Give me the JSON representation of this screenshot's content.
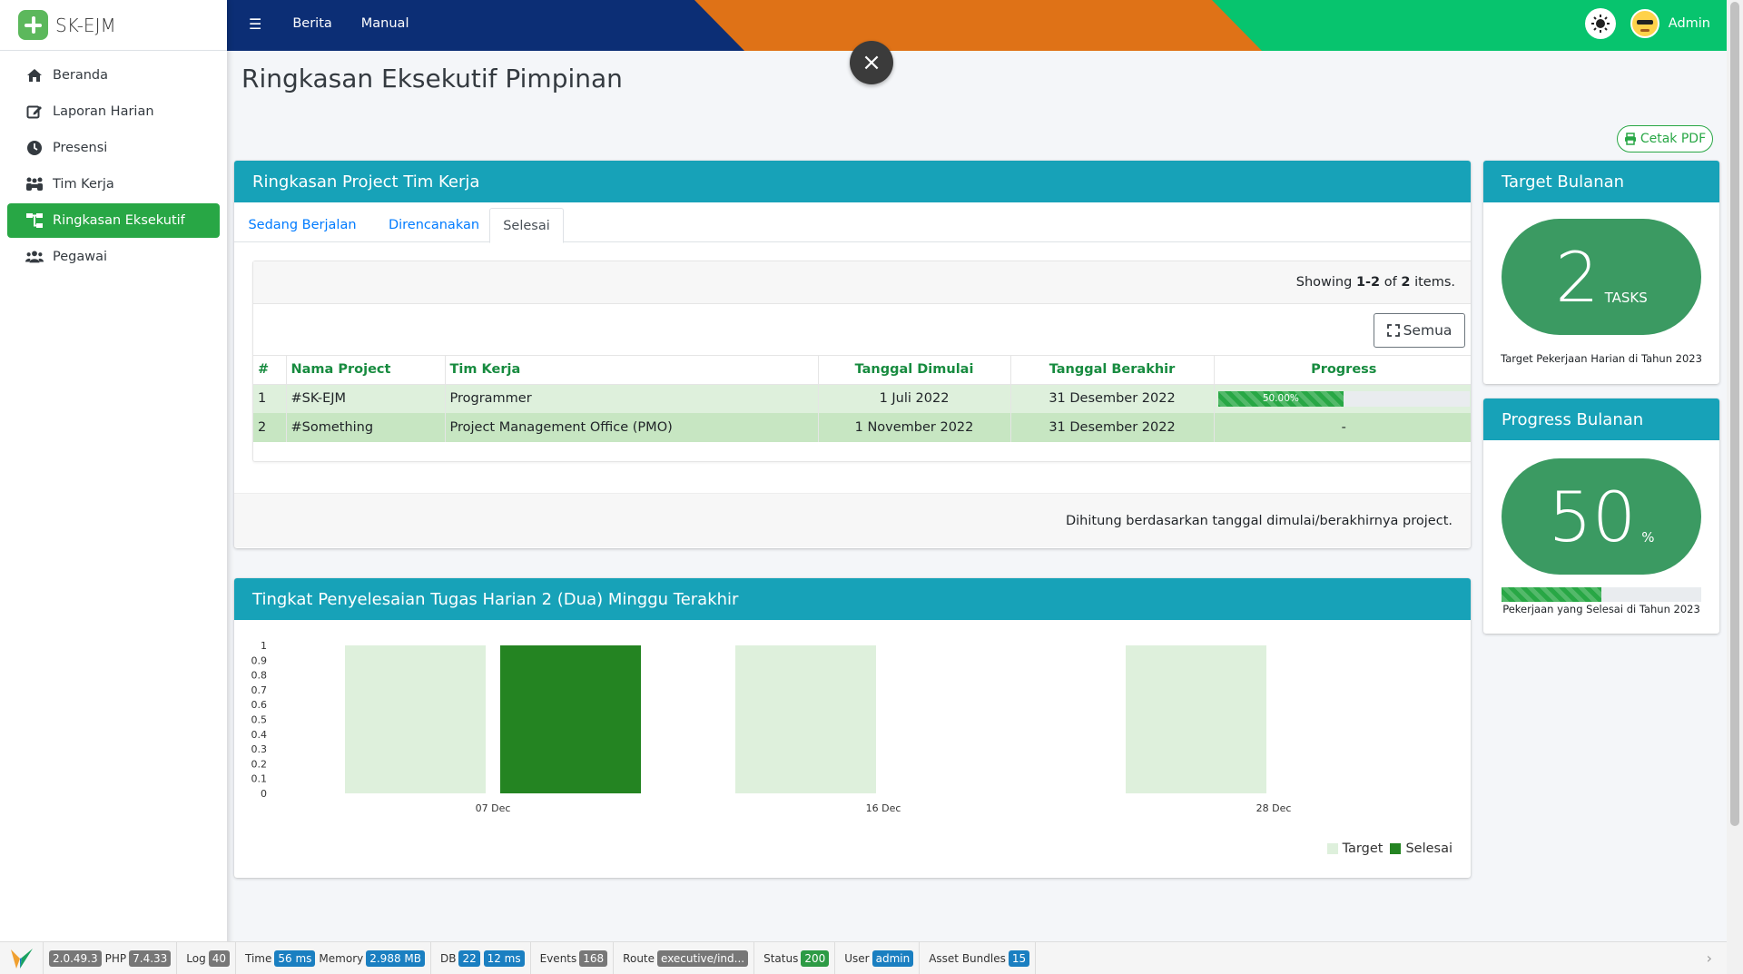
{
  "brand": {
    "name": "SK-EJM"
  },
  "sidebar": {
    "items": [
      {
        "label": "Beranda",
        "icon": "home-icon"
      },
      {
        "label": "Laporan Harian",
        "icon": "edit-icon"
      },
      {
        "label": "Presensi",
        "icon": "clock-icon"
      },
      {
        "label": "Tim Kerja",
        "icon": "team-icon"
      },
      {
        "label": "Ringkasan Eksekutif",
        "icon": "sitemap-icon",
        "active": true
      },
      {
        "label": "Pegawai",
        "icon": "users-icon"
      }
    ]
  },
  "topbar": {
    "menu_icon": "☰",
    "links": [
      "Berita",
      "Manual"
    ],
    "user": "Admin"
  },
  "close_label": "×",
  "page": {
    "title": "Ringkasan Eksekutif Pimpinan",
    "pdf_button": "Cetak PDF"
  },
  "project_card": {
    "title": "Ringkasan Project Tim Kerja",
    "tabs": [
      "Sedang Berjalan",
      "Direncanakan",
      "Selesai"
    ],
    "active_tab": 2,
    "summary": {
      "prefix": "Showing ",
      "range": "1-2",
      "mid": " of ",
      "total": "2",
      "suffix": " items."
    },
    "all_button": "Semua",
    "columns": [
      "#",
      "Nama Project",
      "Tim Kerja",
      "Tanggal Dimulai",
      "Tanggal Berakhir",
      "Progress"
    ],
    "rows": [
      {
        "no": "1",
        "name": "#SK-EJM",
        "team": "Programmer",
        "start": "1 Juli 2022",
        "end": "31 Desember 2022",
        "progress": 0.5,
        "progress_label": "50.00%"
      },
      {
        "no": "2",
        "name": "#Something",
        "team": "Project Management Office (PMO)",
        "start": "1 November 2022",
        "end": "31 Desember 2022",
        "progress_label": "-"
      }
    ],
    "footnote": "Dihitung berdasarkan tanggal dimulai/berakhirnya project."
  },
  "target_card": {
    "title": "Target Bulanan",
    "value": "2",
    "unit": "TASKS",
    "caption": "Target Pekerjaan Harian di Tahun 2023"
  },
  "progress_card": {
    "title": "Progress Bulanan",
    "value": "50",
    "unit": "%",
    "fraction": 0.5,
    "caption": "Pekerjaan yang Selesai di Tahun 2023"
  },
  "chart_card": {
    "title": "Tingkat Penyelesaian Tugas Harian 2 (Dua) Minggu Terakhir"
  },
  "chart_data": {
    "type": "bar",
    "categories": [
      "07 Dec",
      "16 Dec",
      "28 Dec"
    ],
    "series": [
      {
        "name": "Target",
        "values": [
          1,
          1,
          1
        ],
        "color": "#def0dc"
      },
      {
        "name": "Selesai",
        "values": [
          1,
          0,
          0
        ],
        "color": "#248422"
      }
    ],
    "ylim": [
      0,
      1
    ],
    "yticks": [
      "1",
      "0.9",
      "0.8",
      "0.7",
      "0.6",
      "0.5",
      "0.4",
      "0.3",
      "0.2",
      "0.1",
      "0"
    ],
    "legend": "bottom-right"
  },
  "debug": {
    "version": "2.0.49.3",
    "php_label": "PHP",
    "php": "7.4.33",
    "items": [
      {
        "label": "Log",
        "value": "40",
        "style": ""
      },
      {
        "label": "Time",
        "value": "56 ms",
        "style": "info",
        "label2": "Memory",
        "value2": "2.988 MB"
      },
      {
        "label": "DB",
        "value": "22",
        "style": "info",
        "value2": "12 ms"
      },
      {
        "label": "Events",
        "value": "168",
        "style": ""
      },
      {
        "label": "Route",
        "value": "executive/ind...",
        "style": ""
      },
      {
        "label": "Status",
        "value": "200",
        "style": "ok"
      },
      {
        "label": "User",
        "value": "admin",
        "style": "info"
      },
      {
        "label": "Asset Bundles",
        "value": "15",
        "style": "info"
      }
    ],
    "arrow": "›"
  }
}
